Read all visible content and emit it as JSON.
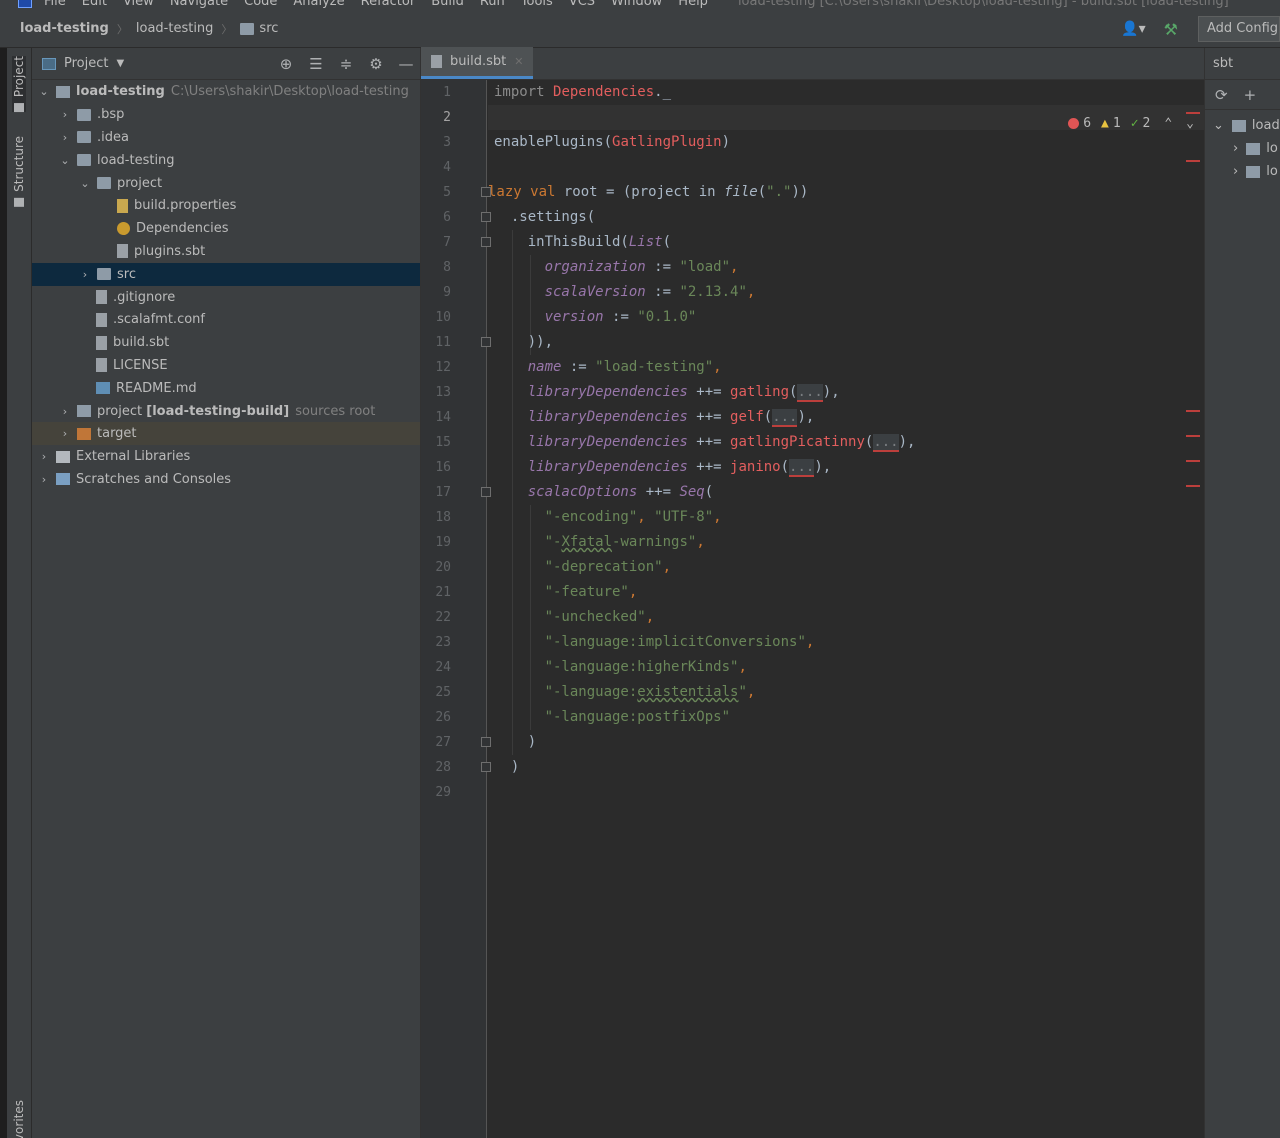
{
  "menubar": {
    "items": [
      "File",
      "Edit",
      "View",
      "Navigate",
      "Code",
      "Analyze",
      "Refactor",
      "Build",
      "Run",
      "Tools",
      "VCS",
      "Window",
      "Help"
    ],
    "window_title": "load-testing [C:\\Users\\shakir\\Desktop\\load-testing] - build.sbt [load-testing]"
  },
  "breadcrumbs": [
    "load-testing",
    "load-testing",
    "src"
  ],
  "navbar": {
    "add_config_label": "Add Config"
  },
  "left_strip": {
    "project_tab": "Project",
    "structure_tab": "Structure",
    "favorites_tab": "vorites"
  },
  "project_panel": {
    "title": "Project",
    "tree": [
      {
        "label": "load-testing",
        "hint": "C:\\Users\\shakir\\Desktop\\load-testing",
        "bold": true
      },
      {
        "label": ".bsp"
      },
      {
        "label": ".idea"
      },
      {
        "label": "load-testing"
      },
      {
        "label": "project"
      },
      {
        "label": "build.properties"
      },
      {
        "label": "Dependencies"
      },
      {
        "label": "plugins.sbt"
      },
      {
        "label": "src"
      },
      {
        "label": ".gitignore"
      },
      {
        "label": ".scalafmt.conf"
      },
      {
        "label": "build.sbt"
      },
      {
        "label": "LICENSE"
      },
      {
        "label": "README.md"
      },
      {
        "label": "project",
        "bold_suffix": "[load-testing-build]",
        "hint": "sources root"
      },
      {
        "label": "target"
      },
      {
        "label": "External Libraries"
      },
      {
        "label": "Scratches and Consoles"
      }
    ]
  },
  "editor": {
    "tab_label": "build.sbt",
    "current_line": 2,
    "line_numbers": [
      "1",
      "2",
      "3",
      "4",
      "5",
      "6",
      "7",
      "8",
      "9",
      "10",
      "11",
      "12",
      "13",
      "14",
      "15",
      "16",
      "17",
      "18",
      "19",
      "20",
      "21",
      "22",
      "23",
      "24",
      "25",
      "26",
      "27",
      "28",
      "29"
    ],
    "inspections": {
      "errors": "6",
      "warnings": "1",
      "weak_warnings": "2"
    },
    "fold_placeholder": "...",
    "code": {
      "l1_a": "import ",
      "l1_b": "Dependencies",
      "l1_c": "._",
      "l3_a": "enablePlugins(",
      "l3_b": "GatlingPlugin",
      "l3_c": ")",
      "l5_a": "lazy val ",
      "l5_b": "root = (project in ",
      "l5_c": "file",
      "l5_d": "(",
      "l5_e": "\".\"",
      "l5_f": "))",
      "l6": "  .settings(",
      "l7_a": "    inThisBuild(",
      "l7_b": "List",
      "l7_c": "(",
      "l8_a": "      ",
      "l8_b": "organization",
      "l8_c": " := ",
      "l8_d": "\"load\"",
      "l8_e": ",",
      "l9_a": "      ",
      "l9_b": "scalaVersion",
      "l9_c": " := ",
      "l9_d": "\"2.13.4\"",
      "l9_e": ",",
      "l10_a": "      ",
      "l10_b": "version",
      "l10_c": " := ",
      "l10_d": "\"0.1.0\"",
      "l11": "    )),",
      "l12_a": "    ",
      "l12_b": "name",
      "l12_c": " := ",
      "l12_d": "\"load-testing\"",
      "l12_e": ",",
      "l13_a": "    ",
      "l13_b": "libraryDependencies",
      "l13_c": " ++= ",
      "l13_d": "gatling",
      "l13_e": "(",
      "l13_f": "),",
      "l14_a": "    ",
      "l14_b": "libraryDependencies",
      "l14_c": " ++= ",
      "l14_d": "gelf",
      "l14_e": "(",
      "l14_f": "),",
      "l15_a": "    ",
      "l15_b": "libraryDependencies",
      "l15_c": " ++= ",
      "l15_d": "gatlingPicatinny",
      "l15_e": "(",
      "l15_f": "),",
      "l16_a": "    ",
      "l16_b": "libraryDependencies",
      "l16_c": " ++= ",
      "l16_d": "janino",
      "l16_e": "(",
      "l16_f": "),",
      "l17_a": "    ",
      "l17_b": "scalacOptions",
      "l17_c": " ++= ",
      "l17_d": "Seq",
      "l17_e": "(",
      "l18_a": "      ",
      "l18_b": "\"-encoding\"",
      "l18_c": ", ",
      "l18_d": "\"UTF-8\"",
      "l18_e": ",",
      "l19_a": "      ",
      "l19_b": "\"-",
      "l19_c": "Xfatal",
      "l19_d": "-warnings\"",
      "l19_e": ",",
      "l20_a": "      ",
      "l20_b": "\"-deprecation\"",
      "l20_c": ",",
      "l21_a": "      ",
      "l21_b": "\"-feature\"",
      "l21_c": ",",
      "l22_a": "      ",
      "l22_b": "\"-unchecked\"",
      "l22_c": ",",
      "l23_a": "      ",
      "l23_b": "\"-language:implicitConversions\"",
      "l23_c": ",",
      "l24_a": "      ",
      "l24_b": "\"-language:higherKinds\"",
      "l24_c": ",",
      "l25_a": "      ",
      "l25_b": "\"-language:",
      "l25_c": "existentials",
      "l25_d": "\"",
      "l25_e": ",",
      "l26_a": "      ",
      "l26_b": "\"-language:postfixOps\"",
      "l27": "    )",
      "l28": "  )"
    }
  },
  "sbt_panel": {
    "title": "sbt",
    "tree": [
      "load",
      "lo",
      "lo"
    ]
  },
  "colors": {
    "selection": "#0d293e",
    "excluded": "#45433b",
    "accent_tab": "#4a88c7"
  }
}
